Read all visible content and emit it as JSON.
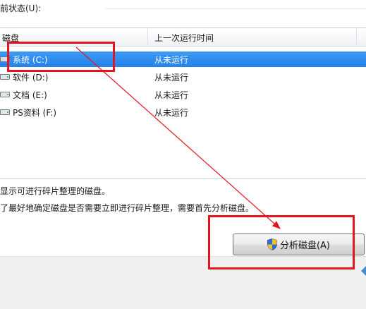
{
  "status": {
    "label": "前状态(U):"
  },
  "list": {
    "columns": [
      {
        "label": "磁盘"
      },
      {
        "label": "上一次运行时间"
      }
    ],
    "rows": [
      {
        "name": "系统 (C:)",
        "last_run": "从未运行",
        "selected": true
      },
      {
        "name": "软件 (D:)",
        "last_run": "从未运行",
        "selected": false
      },
      {
        "name": "文档 (E:)",
        "last_run": "从未运行",
        "selected": false
      },
      {
        "name": "PS资料 (F:)",
        "last_run": "从未运行",
        "selected": false
      }
    ]
  },
  "info": {
    "line1": "显示可进行碎片整理的磁盘。",
    "line2": "了最好地确定磁盘是否需要立即进行碎片整理，需要首先分析磁盘。"
  },
  "buttons": {
    "analyze_label": "分析磁盘(A)"
  },
  "icons": {
    "drive": "hard-drive-icon",
    "analyze": "uac-shield-icon"
  },
  "colors": {
    "selection": "#2a86ee",
    "annotation": "#e6141e"
  }
}
